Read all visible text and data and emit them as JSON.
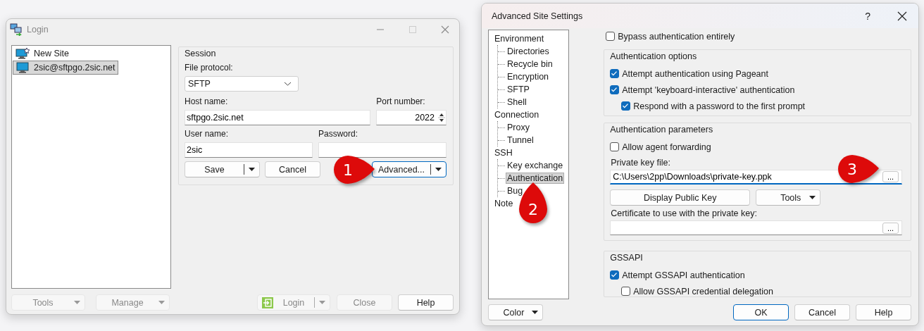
{
  "login_window": {
    "title": "Login",
    "sites": [
      {
        "label": "New Site",
        "kind": "new",
        "selected": false
      },
      {
        "label": "2sic@sftpgo.2sic.net",
        "kind": "site",
        "selected": true
      }
    ],
    "session": {
      "title": "Session",
      "file_protocol": {
        "label": "File protocol:",
        "value": "SFTP"
      },
      "host_name": {
        "label": "Host name:",
        "value": "sftpgo.2sic.net"
      },
      "port_number": {
        "label": "Port number:",
        "value": "2022"
      },
      "user_name": {
        "label": "User name:",
        "value": "2sic"
      },
      "password": {
        "label": "Password:"
      },
      "buttons": [
        {
          "label": "Save",
          "kind": "split",
          "focused": false
        },
        {
          "label": "Cancel",
          "kind": "plain",
          "focused": false
        },
        {
          "label": "Advanced...",
          "kind": "split",
          "focused": true
        }
      ]
    },
    "footer_buttons": [
      {
        "label": "Tools",
        "kind": "dropdown",
        "disabled": true
      },
      {
        "label": "Manage",
        "kind": "dropdown",
        "disabled": true
      },
      {
        "label": "Login",
        "kind": "login",
        "disabled": true
      },
      {
        "label": "Close",
        "kind": "plain",
        "disabled": true
      },
      {
        "label": "Help",
        "kind": "plain",
        "disabled": false
      }
    ]
  },
  "advanced_window": {
    "title": "Advanced Site Settings",
    "help": "?",
    "tree": [
      {
        "label": "Environment",
        "selected": false,
        "children": [
          {
            "label": "Directories",
            "selected": false
          },
          {
            "label": "Recycle bin",
            "selected": false
          },
          {
            "label": "Encryption",
            "selected": false
          },
          {
            "label": "SFTP",
            "selected": false
          },
          {
            "label": "Shell",
            "selected": false
          }
        ]
      },
      {
        "label": "Connection",
        "selected": false,
        "children": [
          {
            "label": "Proxy",
            "selected": false
          },
          {
            "label": "Tunnel",
            "selected": false
          }
        ]
      },
      {
        "label": "SSH",
        "selected": false,
        "children": [
          {
            "label": "Key exchange",
            "selected": false
          },
          {
            "label": "Authentication",
            "selected": true
          },
          {
            "label": "Bug",
            "selected": false
          }
        ]
      },
      {
        "label": "Note",
        "selected": false
      }
    ],
    "bypass": {
      "label": "Bypass authentication entirely",
      "checked": false
    },
    "groups": [
      {
        "title": "Authentication options",
        "items": [
          {
            "kind": "checkbox",
            "label": "Attempt authentication using Pageant",
            "checked": true
          },
          {
            "kind": "checkbox",
            "label": "Attempt 'keyboard-interactive' authentication",
            "checked": true,
            "children": [
              {
                "kind": "checkbox",
                "label": "Respond with a password to the first prompt",
                "checked": true
              }
            ]
          }
        ]
      },
      {
        "title": "Authentication parameters",
        "items": [
          {
            "kind": "checkbox",
            "label": "Allow agent forwarding",
            "checked": false
          },
          {
            "kind": "label",
            "label": "Private key file:"
          },
          {
            "kind": "file_field",
            "value": "C:\\Users\\2pp\\Downloads\\private-key.ppk",
            "browse": "...",
            "focused": true
          },
          {
            "kind": "buttons",
            "buttons": [
              {
                "label": "Display Public Key",
                "kind": "plain"
              },
              {
                "label": "Tools",
                "kind": "dropdown"
              }
            ]
          },
          {
            "kind": "label",
            "label": "Certificate to use with the private key:"
          },
          {
            "kind": "file_field",
            "browse": "...",
            "focused": false
          }
        ]
      },
      {
        "title": "GSSAPI",
        "items": [
          {
            "kind": "checkbox",
            "label": "Attempt GSSAPI authentication",
            "checked": true,
            "children": [
              {
                "kind": "checkbox",
                "label": "Allow GSSAPI credential delegation",
                "checked": false
              }
            ]
          }
        ]
      }
    ],
    "color_button": {
      "label": "Color",
      "kind": "dropdown"
    },
    "footer_buttons": [
      {
        "label": "OK",
        "default": true
      },
      {
        "label": "Cancel",
        "default": false
      },
      {
        "label": "Help",
        "default": false
      }
    ]
  },
  "callouts": [
    {
      "number": "1",
      "kind": "right"
    },
    {
      "number": "2",
      "kind": "up"
    },
    {
      "number": "3",
      "kind": "right"
    }
  ]
}
